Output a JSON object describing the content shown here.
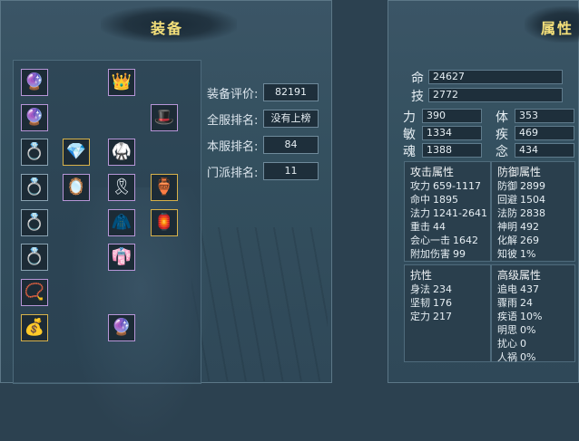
{
  "equipment": {
    "title": "装备",
    "rank": [
      {
        "label": "装备评价:",
        "value": "82191"
      },
      {
        "label": "全服排名:",
        "value": "没有上榜"
      },
      {
        "label": "本服排名:",
        "value": "84"
      },
      {
        "label": "门派排名:",
        "value": "11"
      }
    ]
  },
  "attributes": {
    "title": "属性",
    "life": {
      "label": "命",
      "value": "24627"
    },
    "skill": {
      "label": "技",
      "value": "2772"
    },
    "base": [
      {
        "label": "力",
        "value": "390"
      },
      {
        "label": "体",
        "value": "353"
      },
      {
        "label": "敏",
        "value": "1334"
      },
      {
        "label": "疾",
        "value": "469"
      },
      {
        "label": "魂",
        "value": "1388"
      },
      {
        "label": "念",
        "value": "434"
      }
    ],
    "attack": {
      "title": "攻击属性",
      "rows": [
        {
          "k": "攻力",
          "v": "659-1117"
        },
        {
          "k": "命中",
          "v": "1895"
        },
        {
          "k": "法力",
          "v": "1241-2641"
        },
        {
          "k": "重击",
          "v": "44"
        },
        {
          "k": "会心一击",
          "v": "1642"
        },
        {
          "k": "附加伤害",
          "v": "99"
        }
      ]
    },
    "defense": {
      "title": "防御属性",
      "rows": [
        {
          "k": "防御",
          "v": "2899"
        },
        {
          "k": "回避",
          "v": "1504"
        },
        {
          "k": "法防",
          "v": "2838"
        },
        {
          "k": "神明",
          "v": "492"
        },
        {
          "k": "化解",
          "v": "269"
        },
        {
          "k": "知彼",
          "v": "1%"
        }
      ]
    },
    "resist": {
      "title": "抗性",
      "rows": [
        {
          "k": "身法",
          "v": "234"
        },
        {
          "k": "坚韧",
          "v": "176"
        },
        {
          "k": "定力",
          "v": "217"
        }
      ]
    },
    "advanced": {
      "title": "高级属性",
      "rows": [
        {
          "k": "追电",
          "v": "437"
        },
        {
          "k": "骤雨",
          "v": "24"
        },
        {
          "k": "疾语",
          "v": "10%"
        },
        {
          "k": "明思",
          "v": "0%"
        },
        {
          "k": "扰心",
          "v": "0"
        },
        {
          "k": "人祸",
          "v": "0%"
        }
      ]
    }
  },
  "icons": [
    "purple-orb-icon",
    "winged-helm-icon",
    "purple-orb-icon",
    "white-hood-icon",
    "blue-ring-icon",
    "pink-crystal-icon",
    "armor-icon",
    "blue-ring-icon",
    "hand-mirror-icon",
    "dark-belt-icon",
    "amulet-icon",
    "blue-ring-icon",
    "purple-cloak-icon",
    "lantern-icon",
    "blue-ring-icon",
    "dark-robe-icon",
    "purple-necklace-icon",
    "gold-bag-icon",
    "violet-orb-icon"
  ],
  "colors": {
    "title_gold": "#f4e07a",
    "panel_bg": "#34505f",
    "accent_purple": "#b796d8"
  }
}
